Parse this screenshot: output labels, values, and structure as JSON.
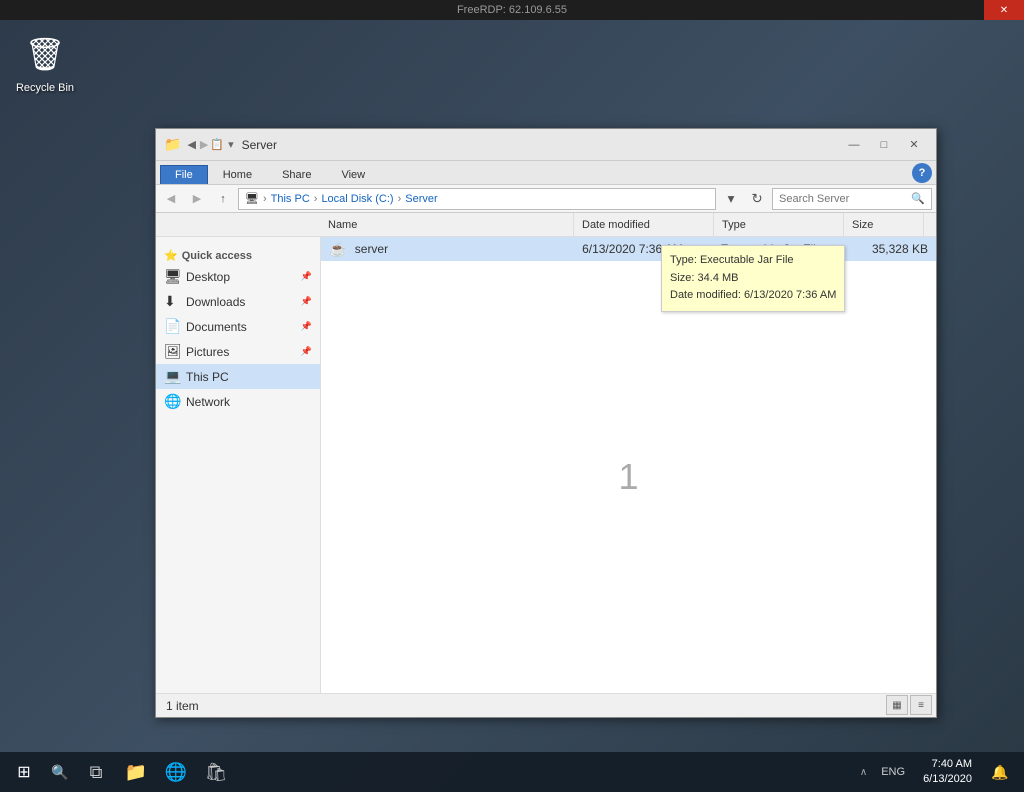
{
  "freerdp": {
    "title": "FreeRDP: 62.109.6.55",
    "close": "✕"
  },
  "desktop": {
    "recycle_bin": {
      "label": "Recycle Bin",
      "icon": "🗑"
    }
  },
  "explorer": {
    "title": "Server",
    "title_icon": "📁",
    "controls": {
      "minimize": "—",
      "maximize": "□",
      "close": "✕"
    },
    "quick_toolbar": {
      "items": [
        "▾",
        "↩",
        "↪",
        "▾"
      ]
    },
    "ribbon": {
      "tabs": [
        {
          "label": "File",
          "active": true
        },
        {
          "label": "Home",
          "active": false
        },
        {
          "label": "Share",
          "active": false
        },
        {
          "label": "View",
          "active": false
        }
      ],
      "help": "?"
    },
    "address": {
      "path": [
        "This PC",
        "Local Disk (C:)",
        "Server"
      ],
      "search_placeholder": "Search Server"
    },
    "columns": {
      "name": "Name",
      "date_modified": "Date modified",
      "type": "Type",
      "size": "Size"
    },
    "nav": {
      "items": [
        {
          "label": "Quick access",
          "icon": "⭐",
          "pin": false,
          "section_header": true
        },
        {
          "label": "Desktop",
          "icon": "🖥",
          "pin": true
        },
        {
          "label": "Downloads",
          "icon": "⬇",
          "pin": true
        },
        {
          "label": "Documents",
          "icon": "📄",
          "pin": true
        },
        {
          "label": "Pictures",
          "icon": "🖼",
          "pin": true
        },
        {
          "label": "This PC",
          "icon": "💻",
          "active": true
        },
        {
          "label": "Network",
          "icon": "🌐"
        }
      ]
    },
    "files": [
      {
        "name": "server",
        "icon": "☕",
        "date_modified": "6/13/2020 7:36 AM",
        "type": "Executable Jar File",
        "size": "35,328 KB",
        "selected": true
      }
    ],
    "tooltip": {
      "type_label": "Type:",
      "type_value": "Executable Jar File",
      "size_label": "Size:",
      "size_value": "34.4 MB",
      "date_label": "Date modified:",
      "date_value": "6/13/2020 7:36 AM"
    },
    "center_number": "1",
    "status": {
      "item_count": "1 item"
    },
    "view_buttons": [
      "▦",
      "≡"
    ]
  },
  "taskbar": {
    "start_icon": "⊞",
    "search_icon": "🔍",
    "task_view_icon": "⧉",
    "file_explorer_icon": "📁",
    "edge_icon": "🌐",
    "store_icon": "🛍",
    "system": {
      "chevron": "∧",
      "keyboard": "ENG",
      "time": "7:40 AM",
      "date": "6/13/2020"
    },
    "notification_icon": "🔔"
  }
}
